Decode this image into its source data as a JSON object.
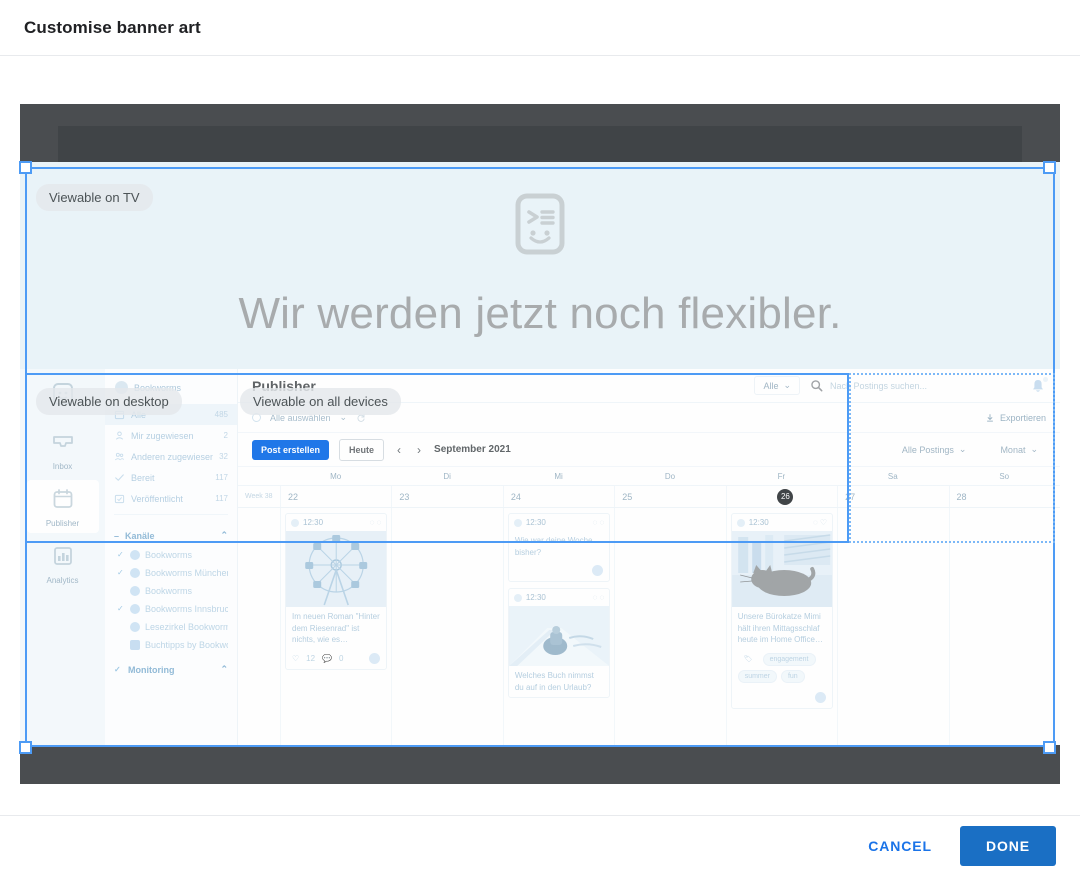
{
  "dialog": {
    "title": "Customise banner art",
    "cancel_label": "CANCEL",
    "done_label": "DONE",
    "accent_color": "#1a73e8",
    "crop_color": "#4d9bf5"
  },
  "crop_badges": [
    {
      "label": "Viewable on TV"
    },
    {
      "label": "Viewable on desktop"
    },
    {
      "label": "Viewable on all devices"
    }
  ],
  "banner": {
    "headline": "Wir werden jetzt noch flexibler.",
    "icon": "chat-face-icon",
    "background_color": "#e9f3f8",
    "headline_color": "#a8abad"
  },
  "app": {
    "rail": [
      {
        "icon": "logo-face-icon",
        "label": ""
      },
      {
        "icon": "inbox-icon",
        "label": "Inbox"
      },
      {
        "icon": "calendar-icon",
        "label": "Publisher"
      },
      {
        "icon": "analytics-icon",
        "label": "Analytics"
      }
    ],
    "sidebar": {
      "account": "Bookworms",
      "items": [
        {
          "icon": "calendar-icon",
          "label": "Alle",
          "count": "485",
          "selected": true
        },
        {
          "icon": "person-icon",
          "label": "Mir zugewiesen",
          "count": "2",
          "selected": false
        },
        {
          "icon": "people-icon",
          "label": "Anderen zugewiesen",
          "count": "32",
          "selected": false
        },
        {
          "icon": "check-icon",
          "label": "Bereit",
          "count": "117",
          "selected": false
        },
        {
          "icon": "calendar-check-icon",
          "label": "Veröffentlicht",
          "count": "117",
          "selected": false
        }
      ],
      "groups": [
        {
          "label": "Kanäle",
          "channels": [
            {
              "name": "Bookworms",
              "network": "facebook",
              "checked": true
            },
            {
              "name": "Bookworms München",
              "network": "facebook",
              "checked": true
            },
            {
              "name": "Bookworms",
              "network": "twitter",
              "checked": false
            },
            {
              "name": "Bookworms Innsbruck",
              "network": "facebook",
              "checked": true
            },
            {
              "name": "Lesezirkel Bookworms",
              "network": "instagram",
              "checked": false
            },
            {
              "name": "Buchtipps by Bookworms",
              "network": "other",
              "checked": false
            }
          ]
        },
        {
          "label": "Monitoring",
          "channels": []
        }
      ]
    },
    "topbar": {
      "title": "Publisher",
      "filter_value": "Alle",
      "search_placeholder": "Nach Postings suchen...",
      "search_icon": "search-icon",
      "bell_icon": "bell-icon"
    },
    "selbar": {
      "select_all_label": "Alle auswählen",
      "refresh_icon": "refresh-icon",
      "export_label": "Exportieren",
      "export_icon": "download-icon"
    },
    "navbar": {
      "create_label": "Post erstellen",
      "today_label": "Heute",
      "prev_icon": "chevron-left-icon",
      "next_icon": "chevron-right-icon",
      "month_label": "September 2021",
      "posts_filter": "Alle Postings",
      "view_filter": "Monat"
    },
    "calendar": {
      "week_label": "Week 38",
      "day_names": [
        "Mo",
        "Di",
        "Mi",
        "Do",
        "Fr",
        "Sa",
        "So"
      ],
      "dates": [
        "22",
        "23",
        "24",
        "25",
        "26",
        "27",
        "28"
      ],
      "today_index": 4,
      "posts": [
        {
          "column": 0,
          "time": "12:30",
          "image": "ferris-wheel",
          "text": "Im neuen Roman \"Hinter dem Riesenrad\" ist nichts, wie es…",
          "likes": "12",
          "comments": "0",
          "tags": []
        },
        {
          "column": 2,
          "time": "12:30",
          "image": "",
          "text": "Wie war deine Woche bisher?",
          "likes": "",
          "comments": "",
          "tags": []
        },
        {
          "column": 2,
          "time": "12:30",
          "image": "road-bike",
          "text": "Welches Buch nimmst du auf in den Urlaub?",
          "likes": "",
          "comments": "",
          "tags": []
        },
        {
          "column": 4,
          "time": "12:30",
          "image": "sleeping-cat",
          "text": "Unsere Bürokatze Mimi hält ihren Mittagsschlaf heute im Home Office…",
          "likes": "",
          "comments": "",
          "tags": [
            "engagement",
            "summer",
            "fun"
          ]
        }
      ]
    }
  }
}
